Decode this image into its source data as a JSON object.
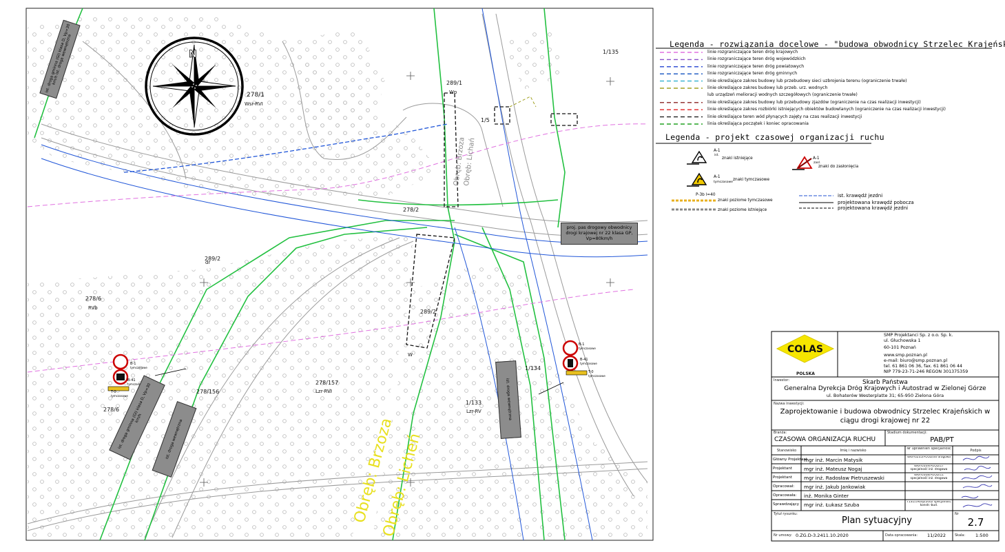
{
  "legend_main": {
    "title": "Legenda - rozwiązania docelowe - \"budowa obwodnicy Strzelec Krajeńskich\"",
    "items": [
      {
        "label": "linie rozgraniczające teren dróg krajowych",
        "color": "#e070e0"
      },
      {
        "label": "linie rozgraniczające teren dróg wojewódzkich",
        "color": "#8a50c8"
      },
      {
        "label": "linie rozgraniczające teren dróg powiatowych",
        "color": "#2040d0"
      },
      {
        "label": "linie rozgraniczające teren dróg gminnych",
        "color": "#1050c0"
      },
      {
        "label": "linie określające zakres budowy lub przebudowy sieci uzbrojenia terenu (ograniczenie trwałe)",
        "color": "#30b0d0"
      },
      {
        "label": "linie określające zakres budowy lub przeb. urz. wodnych",
        "color": "#a0a020"
      },
      {
        "label": "lub urządzeń melioracji wodnych szczegółowych (ograniczenie trwałe)",
        "color": ""
      },
      {
        "label": "linie określające zakres budowy lub przebudowy zjazdów (ograniczenie na czas realizacji inwestycji)",
        "color": "#8a2020"
      },
      {
        "label": "linie określające zakres rozbiórki istniejących obiektów budowlanych (ograniczenie na czas realizacji inwestycji)",
        "color": "#e02020"
      },
      {
        "label": "linie określające teren wód płynących zajęty na czas realizacji inwestycji",
        "color": "#202020"
      },
      {
        "label": "linia określająca początek i koniec opracowania",
        "color": "#20a020"
      }
    ]
  },
  "legend_toc": {
    "title": "Legenda - projekt czasowej organizacji ruchu",
    "signs": [
      {
        "code": "A-1",
        "sub": "ist.",
        "label": "znaki istniejące"
      },
      {
        "code": "A-1",
        "sub": "tymczasowe",
        "label": "znaki tymczasowe"
      },
      {
        "code": "A-1",
        "sub": "zasł.",
        "label": "znaki do zasłonięcia"
      }
    ],
    "marking_temp_code": "P-3b l=40",
    "marking_temp_label": "znaki poziome tymczasowe",
    "marking_exist_label": "znaki poziome istniejące",
    "lines": [
      {
        "label": "ist. krawędź jezdni",
        "color": "#2050d0"
      },
      {
        "label": "projektowana krawędź pobocza",
        "color": "#000000"
      },
      {
        "label": "projektowana krawędź jezdni",
        "color": "#000000"
      }
    ]
  },
  "map": {
    "colors": {
      "green": "#22c040",
      "pink": "#e070e0",
      "blue": "#1f55d8",
      "grey": "#9a9a9a",
      "yellow": "#e8e020"
    },
    "parcels": [
      "278/1",
      "Wsr-RVI",
      "289/1",
      "Wp",
      "1/5",
      "1/135",
      "278/2",
      "dr",
      "278/6",
      "RVb",
      "289/2",
      "278/156",
      "278/157",
      "Lzr-RVI",
      "1/133",
      "Lzr-RV",
      "1/134",
      "278/6",
      "289/2",
      "W",
      "Obręb: Brzoza",
      "Obręb: Lichań"
    ],
    "boxes": [
      {
        "text": "ist. droga gminna (Gl) klasa D, Vp=30 km/h ist. droga wewnętrzna"
      },
      {
        "text": "proj. pas drogowy obwodnicy drogi krajowej nr 22 klasa GP, Vp=80km/h"
      },
      {
        "text": "ist. droga gminna (Gl) klasa D, Vp=30 km/h"
      },
      {
        "text": "ist. droga wewnętrzna"
      },
      {
        "text": "ist. droga wewnętrzna"
      }
    ],
    "yellow_labels": [
      "Obręb: Brzoza",
      "Obręb: Licheń"
    ],
    "signs_left": [
      "B-1",
      "tymczasowe",
      "B-41",
      "tymczasowe",
      "T-0",
      "tymczasowe"
    ],
    "signs_right": [
      "B-1",
      "tymczasowe",
      "B-41",
      "tymczasowe",
      "T-0",
      "tymczasowe"
    ]
  },
  "titleblock": {
    "company_logo": "COLAS",
    "company_country": "POLSKA",
    "firm": [
      "SMP Projektanci Sp. z o.o. Sp. k.",
      "ul. Głuchowska 1",
      "60-101 Poznań",
      "www.smp.poznan.pl",
      "e-mail: biuro@smp.poznan.pl",
      "tel. 61 861 06 36, fax. 61 861 06 44",
      "NIP 779-23-71-246  REGON 301375359"
    ],
    "investor_label": "Inwestor:",
    "investor": [
      "Skarb Państwa",
      "Generalna Dyrekcja Dróg Krajowych i Autostrad w Zielonej Górze",
      "ul. Bohaterów Westerplatte 31; 65-950 Zielona Góra"
    ],
    "project_label": "Nazwa inwestycji:",
    "project": [
      "Zaprojektowanie i budowa obwodnicy Strzelec Krajeńskich w",
      "ciągu drogi krajowej nr 22"
    ],
    "branch_label": "Branża:",
    "branch": "CZASOWA ORGANIZACJA RUCHU",
    "stage_label": "Stadium dokumentacji:",
    "stage": "PAB/PT",
    "table_headers": [
      "Stanowisko",
      "Imię i nazwisko",
      "Nr uprawnień specjalność",
      "Podpis"
    ],
    "rows": [
      {
        "role": "Główny Projektant",
        "name": "mgr inż. Marcin Matysik",
        "lic": "WKP/0235/POOD/06 drogowa"
      },
      {
        "role": "Projektant",
        "name": "mgr inż. Mateusz Nogaj",
        "lic": "WKP/0349/POOD/17 specjalność inż. drogowa"
      },
      {
        "role": "Projektant",
        "name": "mgr inż. Radosław Pietruszewski",
        "lic": "WKP/0308/POOD/11 specjalność inż. drogowa"
      },
      {
        "role": "Opracował:",
        "name": "mgr inż. Jakub Jankowiak",
        "lic": ""
      },
      {
        "role": "Opracowała:",
        "name": "inż. Monika Ginter",
        "lic": ""
      },
      {
        "role": "Sprawdzający",
        "name": "mgr inż. Łukasz Szuba",
        "lic": "7131/190/ip/2002 specjalność konstr.-bud."
      }
    ],
    "sheet_title_label": "Tytuł rysunku:",
    "sheet_title": "Plan sytuacyjny",
    "number_label": "Nr",
    "number": "2.7",
    "contract_label": "Nr umowy:",
    "contract": "0.ZG.D-3.2411.10.2020",
    "date_label": "Data opracowania:",
    "date": "11/2022",
    "scale_label": "Skala:",
    "scale": "1:500"
  }
}
